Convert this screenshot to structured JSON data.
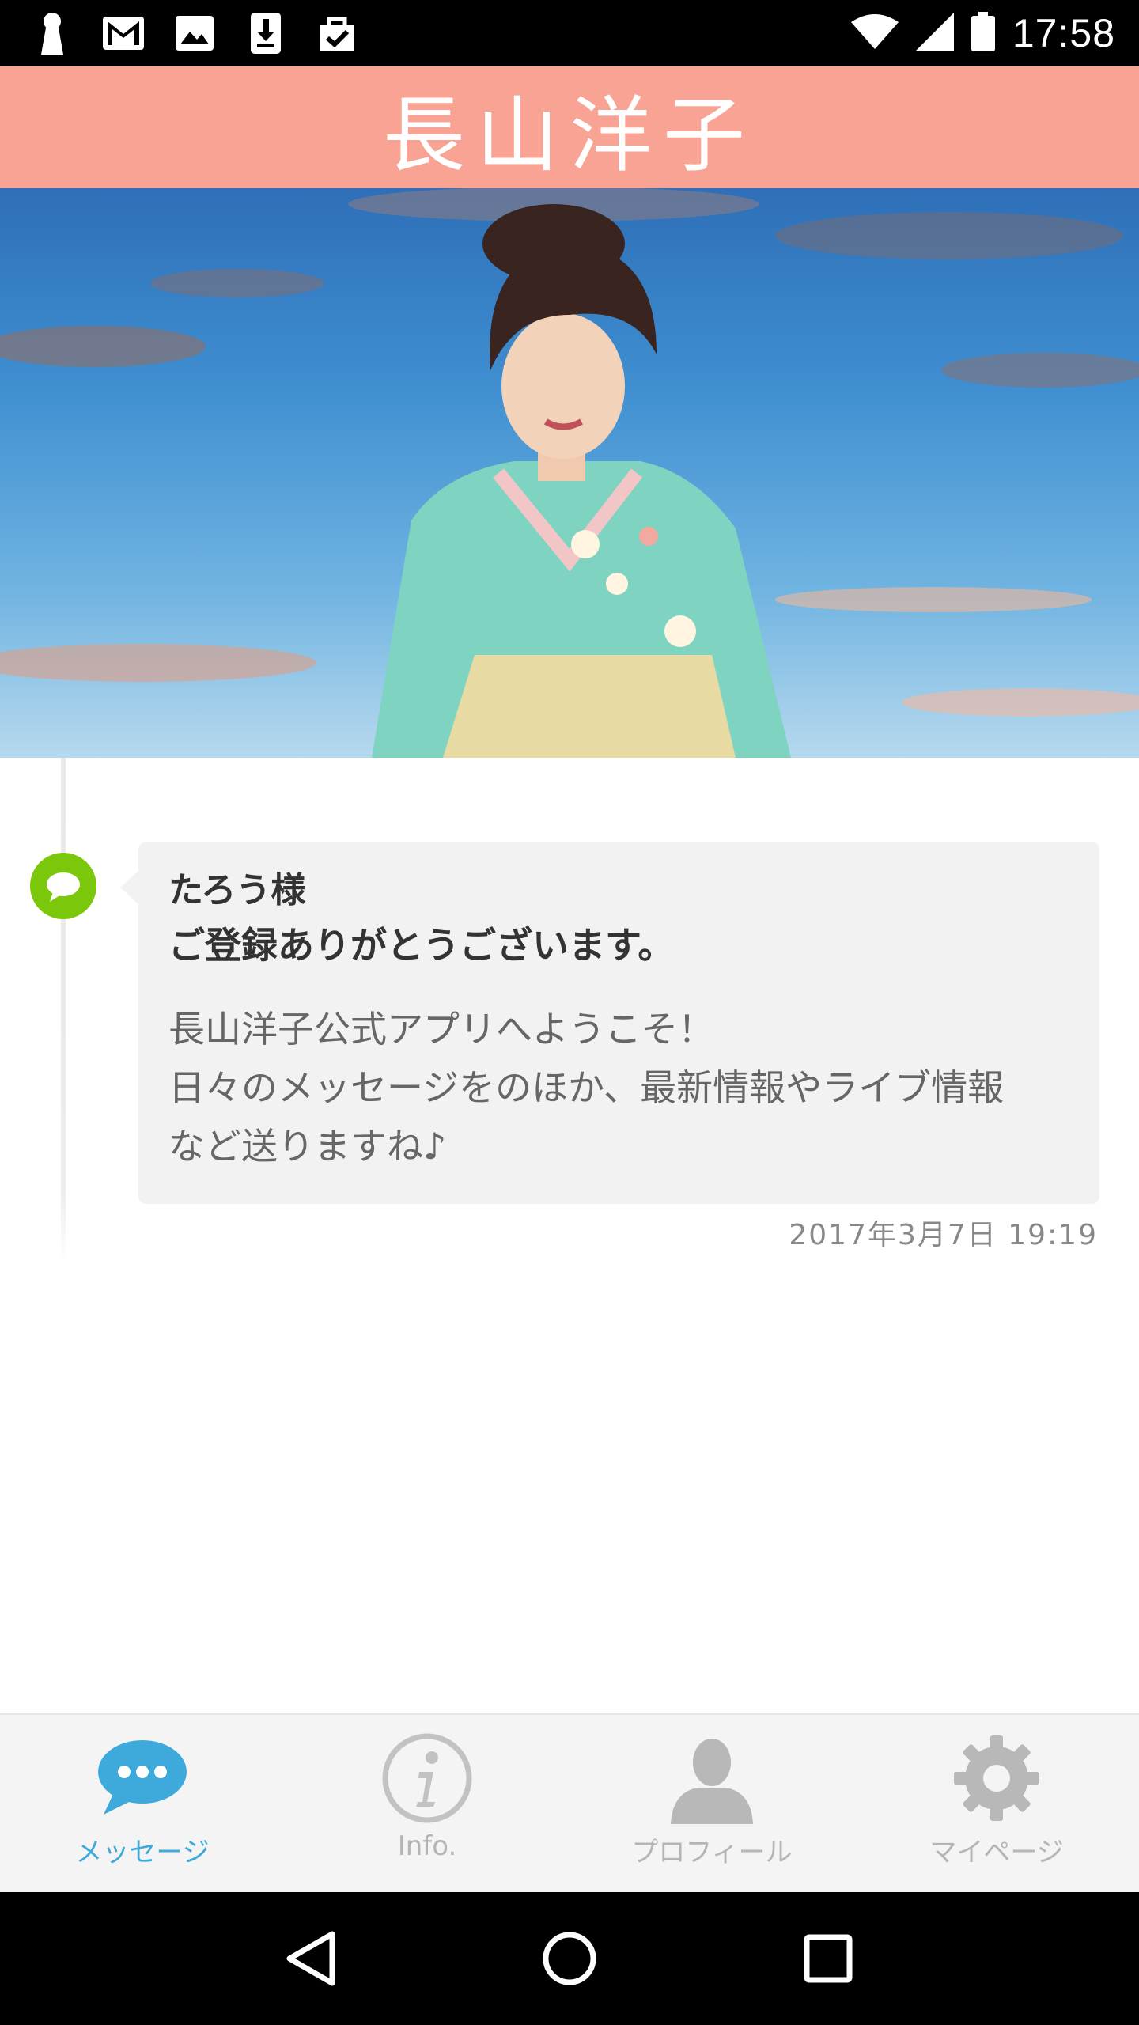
{
  "status_bar": {
    "time": "17:58",
    "left_icons": [
      "keyhole-icon",
      "gmail-icon",
      "image-icon",
      "download-icon",
      "clipboard-check-icon"
    ],
    "right_icons": [
      "wifi-icon",
      "signal-icon",
      "battery-icon"
    ]
  },
  "header": {
    "title": "長山洋子"
  },
  "message": {
    "name": "たろう様",
    "title": "ご登録ありがとうございます。",
    "body": "長山洋子公式アプリへようこそ！\n日々のメッセージをのほか、最新情報やライブ情報\nなど送りますね♪",
    "date": "2017年3月7日 19:19"
  },
  "tabs": [
    {
      "label": "メッセージ",
      "icon": "chat-bubble-icon",
      "active": true
    },
    {
      "label": "Info.",
      "icon": "info-icon",
      "active": false
    },
    {
      "label": "プロフィール",
      "icon": "person-icon",
      "active": false
    },
    {
      "label": "マイページ",
      "icon": "gear-icon",
      "active": false
    }
  ],
  "colors": {
    "header_bg": "#f8a393",
    "accent": "#3eaadb",
    "timeline_dot": "#7ac70c",
    "inactive": "#b5b5b5"
  }
}
